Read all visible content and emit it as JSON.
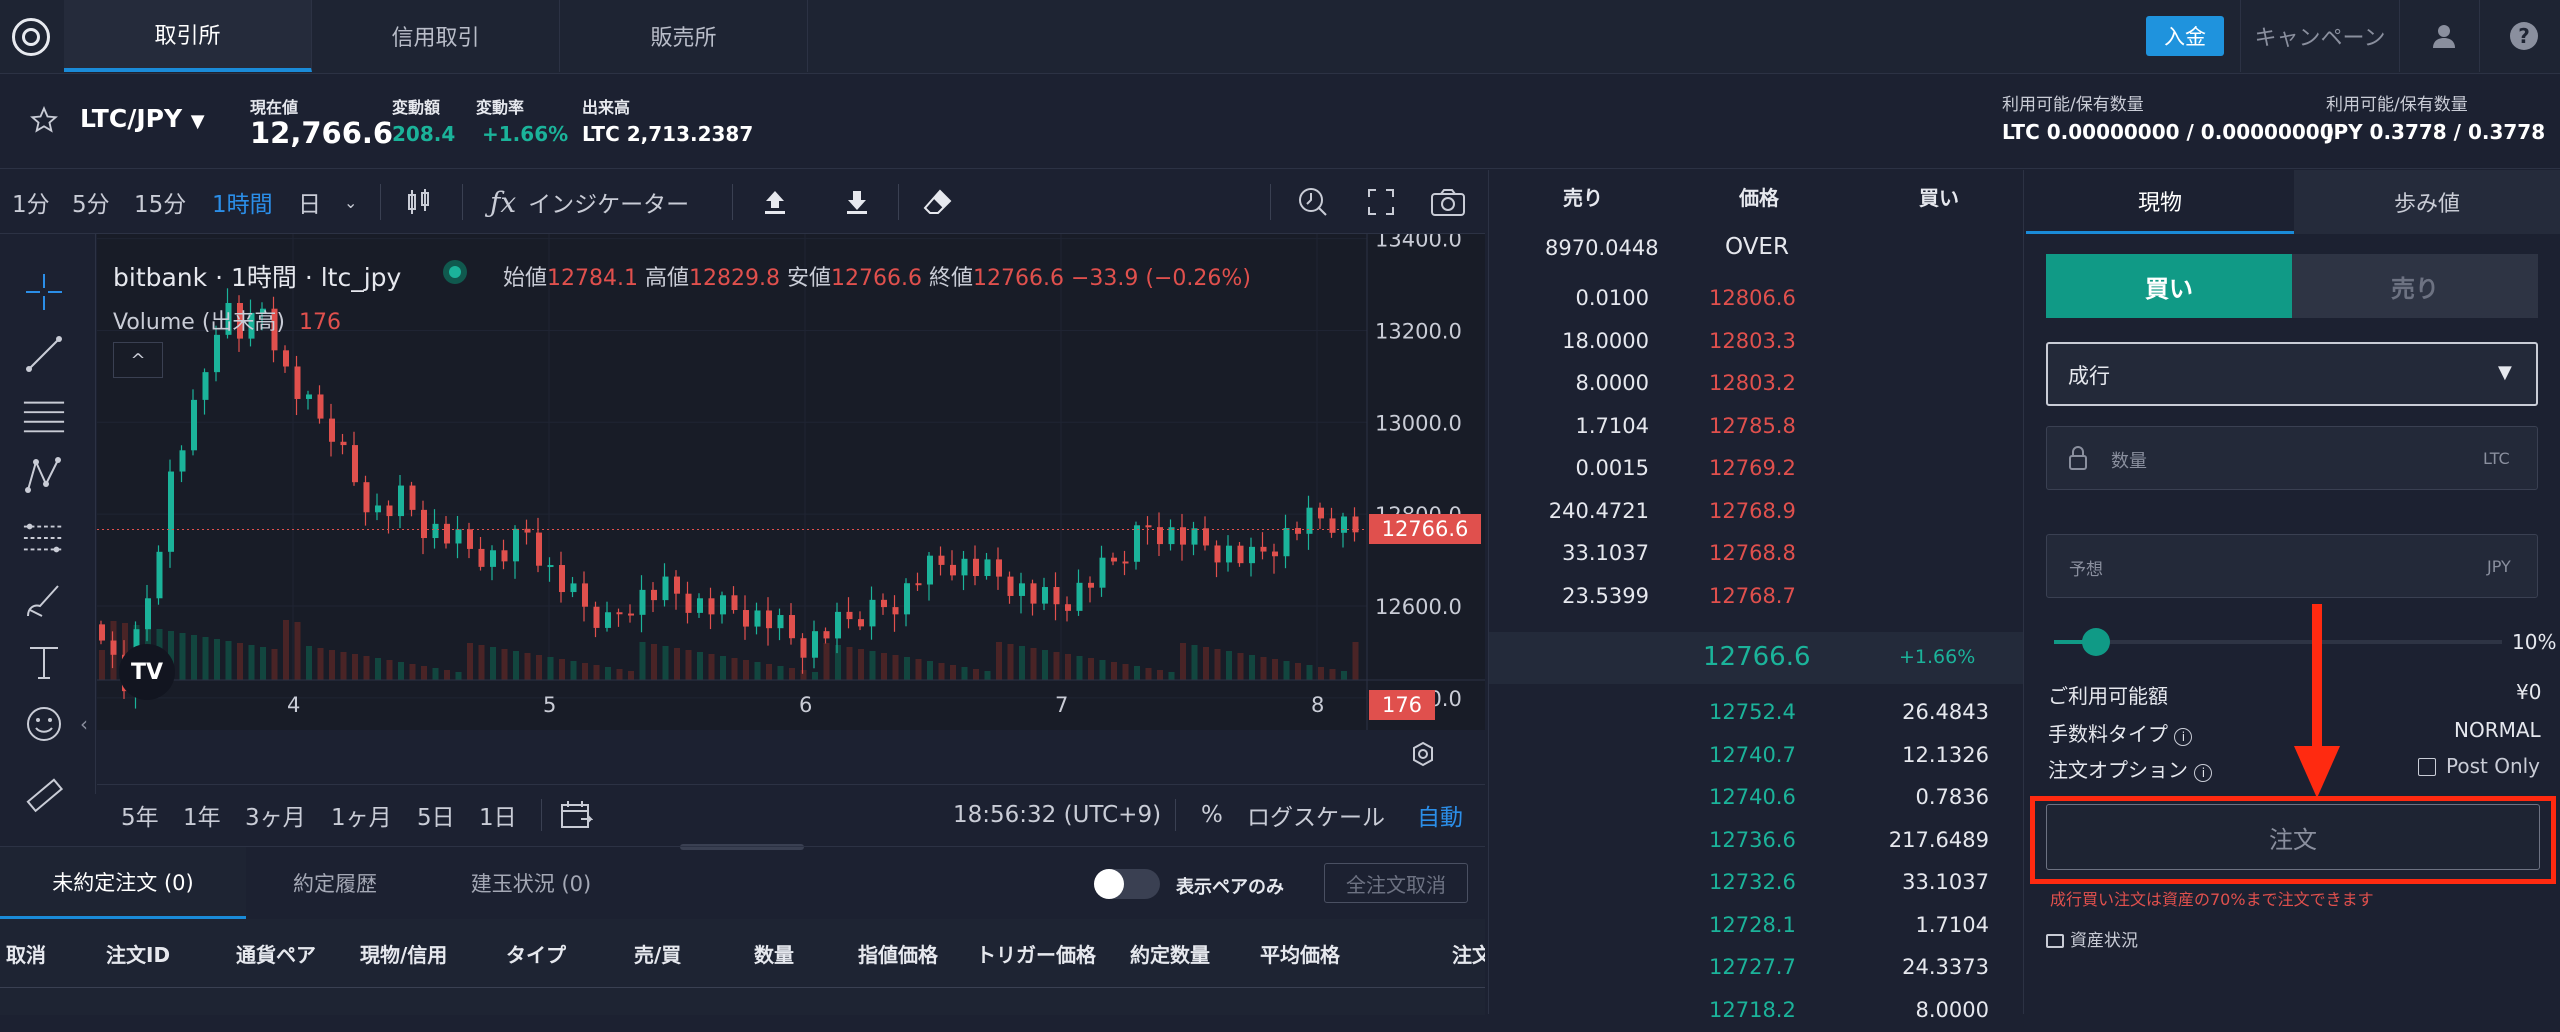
{
  "nav": {
    "tabs": [
      "取引所",
      "信用取引",
      "販売所"
    ],
    "deposit": "入金",
    "campaign": "キャンペーン"
  },
  "ticker": {
    "pair": "LTC/JPY",
    "price_label": "現在値",
    "price": "12,766.6",
    "change_label": "変動額",
    "change": "208.4",
    "rate_label": "変動率",
    "rate": "+1.66%",
    "volume_label": "出来高",
    "volume": "LTC 2,713.2387",
    "avail1_label": "利用可能/保有数量",
    "avail1": "LTC 0.00000000 / 0.00000000",
    "avail2_label": "利用可能/保有数量",
    "avail2": "JPY 0.3778 / 0.3778"
  },
  "toolbar": {
    "intervals": [
      "1分",
      "5分",
      "15分",
      "1時間",
      "日"
    ],
    "active_interval": "1時間",
    "indicator": "インジケーター"
  },
  "chart": {
    "title": "bitbank · 1時間 · ltc_jpy",
    "open_label": "始値",
    "open": "12784.1",
    "high_label": "高値",
    "high": "12829.8",
    "low_label": "安値",
    "low": "12766.6",
    "close_label": "終値",
    "close": "12766.6",
    "change": "−33.9 (−0.26%)",
    "volume_label": "Volume (出来高)",
    "volume": "176",
    "price_badge": "12766.6",
    "vol_badge": "176",
    "logo": "TV"
  },
  "chart_data": {
    "type": "candlestick",
    "y_ticks": [
      "13400.0",
      "13200.0",
      "13000.0",
      "12800.0",
      "12600.0",
      "12400.0"
    ],
    "x_ticks": [
      "4",
      "5",
      "6",
      "7",
      "8"
    ],
    "ylim": [
      12330,
      13410
    ],
    "last": 12766.6
  },
  "chartctrl": {
    "ranges": [
      "5年",
      "1年",
      "3ヶ月",
      "1ヶ月",
      "5日",
      "1日"
    ],
    "time": "18:56:32 (UTC+9)",
    "pct": "%",
    "log": "ログスケール",
    "auto": "自動"
  },
  "orders": {
    "tabs": [
      "未約定注文 (0)",
      "約定履歴",
      "建玉状況 (0)"
    ],
    "toggle_label": "表示ペアのみ",
    "cancel_all": "全注文取消",
    "columns": [
      "取消",
      "注文ID",
      "通貨ペア",
      "現物/信用",
      "タイプ",
      "売/買",
      "数量",
      "指値価格",
      "トリガー価格",
      "約定数量",
      "平均価格",
      "注文"
    ]
  },
  "book": {
    "headers": [
      "売り",
      "価格",
      "買い"
    ],
    "over_qty": "8970.0448",
    "over": "OVER",
    "asks": [
      {
        "q": "0.0100",
        "p": "12806.6"
      },
      {
        "q": "18.0000",
        "p": "12803.3"
      },
      {
        "q": "8.0000",
        "p": "12803.2"
      },
      {
        "q": "1.7104",
        "p": "12785.8"
      },
      {
        "q": "0.0015",
        "p": "12769.2"
      },
      {
        "q": "240.4721",
        "p": "12768.9"
      },
      {
        "q": "33.1037",
        "p": "12768.8"
      },
      {
        "q": "23.5399",
        "p": "12768.7"
      }
    ],
    "mid": "12766.6",
    "mid_rate": "+1.66%",
    "bids": [
      {
        "p": "12752.4",
        "q": "26.4843"
      },
      {
        "p": "12740.7",
        "q": "12.1326"
      },
      {
        "p": "12740.6",
        "q": "0.7836"
      },
      {
        "p": "12736.6",
        "q": "217.6489"
      },
      {
        "p": "12732.6",
        "q": "33.1037"
      },
      {
        "p": "12728.1",
        "q": "1.7104"
      },
      {
        "p": "12727.7",
        "q": "24.3373"
      },
      {
        "p": "12718.2",
        "q": "8.0000"
      }
    ]
  },
  "panel": {
    "tabs": [
      "現物",
      "歩み値"
    ],
    "buy": "買い",
    "sell": "売り",
    "order_type": "成行",
    "qty_placeholder": "数量",
    "qty_unit": "LTC",
    "est_placeholder": "予想",
    "est_unit": "JPY",
    "slider_pct": "10%",
    "available_label": "ご利用可能額",
    "available": "¥0",
    "fee_label": "手数料タイプ",
    "fee": "NORMAL",
    "option_label": "注文オプション",
    "post_only": "Post Only",
    "submit": "注文",
    "warning": "成行買い注文は資産の70%まで注文できます",
    "assets": "資産状況"
  },
  "colors": {
    "accent": "#1a8bd8",
    "up": "#1bb39a",
    "down": "#e0504d",
    "highlight": "#ff2a10"
  }
}
